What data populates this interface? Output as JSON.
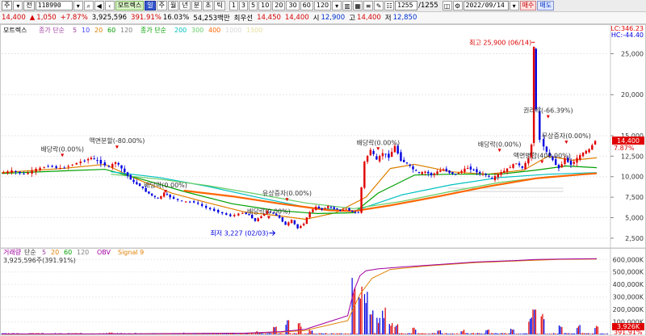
{
  "toolbar": {
    "period_select": "주",
    "mode_select": "전",
    "code": "118990",
    "stock_name": "모트렉스",
    "nav_tabs": [
      "일",
      "주",
      "월",
      "년",
      "분",
      "초",
      "틱"
    ],
    "intervals": [
      "1",
      "3",
      "5",
      "10",
      "20",
      "30",
      "60",
      "120"
    ],
    "range": "1255",
    "range_total": "/1255",
    "date": "2022/09/14",
    "buy_label": "매수",
    "sell_label": "매도"
  },
  "info": {
    "price": "14,400",
    "change_arrow": "▲",
    "change": "1,050",
    "change_pct": "+7.87%",
    "volume": "3,925,596",
    "volume_pct": "391.91%",
    "turnover": "16.03%",
    "amount": "54,253백만",
    "prev_label": "최우선",
    "bid": "14,450",
    "ask": "14,400",
    "open_label": "시",
    "open": "12,900",
    "high_label": "고",
    "high": "14,400",
    "low_label": "저",
    "low": "12,850"
  },
  "colors": {
    "up": "#e00000",
    "down": "#0000e0",
    "ma5": "#a040a0",
    "ma10": "#4040ff",
    "ma20": "#e08000",
    "ma60": "#00a000",
    "ma120": "#808080",
    "ma200": "#00c0c0",
    "ma300": "#66cc66",
    "ma400": "#ff6600",
    "obv": "#a000a0",
    "highlight": "#ffffff"
  },
  "chart_data": [
    {
      "type": "candlestick",
      "title": "모트렉스",
      "legend": {
        "group1_label": "종가 단순",
        "group1": [
          {
            "name": "5",
            "color": "#a040a0"
          },
          {
            "name": "10",
            "color": "#4040ff"
          },
          {
            "name": "20",
            "color": "#e08000"
          },
          {
            "name": "60",
            "color": "#00a000"
          },
          {
            "name": "120",
            "color": "#808080"
          }
        ],
        "group2_label": "종가 단순",
        "group2": [
          {
            "name": "200",
            "color": "#00c0c0"
          },
          {
            "name": "300",
            "color": "#66cc66"
          },
          {
            "name": "400",
            "color": "#ff6600"
          },
          {
            "name": "1000",
            "color": "#d8d8d8"
          },
          {
            "name": "1500",
            "color": "#e8e0a0"
          }
        ]
      },
      "y_ticks": [
        "25,000",
        "20,000",
        "15,000",
        "12,500",
        "10,000",
        "7,500",
        "5,000",
        "2,500"
      ],
      "y_tick_values": [
        25000,
        20000,
        15000,
        12500,
        10000,
        7500,
        5000,
        2500
      ],
      "ylim": [
        1800,
        28000
      ],
      "current_price_label": "14,400",
      "current_change_label": "7.87%",
      "lc_label": "LC:346.23",
      "hc_label": "HC:-44.40",
      "annotations": [
        {
          "text": "배당락(0.00%)",
          "x": 0.1,
          "y": 12300
        },
        {
          "text": "액면분할(-80.00%)",
          "x": 0.19,
          "y": 13300
        },
        {
          "text": "배당락(0.00%)",
          "x": 0.27,
          "y": 7900
        },
        {
          "text": "유상증자(0.00%)",
          "x": 0.47,
          "y": 6900
        },
        {
          "text": "배당락(0.00%)",
          "x": 0.44,
          "y": 4700
        },
        {
          "text": "배당락(0.00%)",
          "x": 0.62,
          "y": 13100
        },
        {
          "text": "배당락(0.00%)",
          "x": 0.82,
          "y": 12900
        },
        {
          "text": "액면병합(400.00%)",
          "x": 0.89,
          "y": 11500
        },
        {
          "text": "권리락(-66.39%)",
          "x": 0.9,
          "y": 17000
        },
        {
          "text": "무상증자(0.00%)",
          "x": 0.93,
          "y": 13900
        },
        {
          "text": "최고 25,900 (06/14)",
          "x": 0.878,
          "y": 25900
        },
        {
          "text": "최저 3,227 (02/03)",
          "x": 0.45,
          "y": 3227
        }
      ],
      "price_series": [
        [
          0.0,
          10400
        ],
        [
          0.02,
          10700
        ],
        [
          0.04,
          10300
        ],
        [
          0.06,
          10900
        ],
        [
          0.08,
          11300
        ],
        [
          0.1,
          11000
        ],
        [
          0.12,
          11500
        ],
        [
          0.14,
          12000
        ],
        [
          0.15,
          12300
        ],
        [
          0.16,
          11900
        ],
        [
          0.18,
          11200
        ],
        [
          0.19,
          11800
        ],
        [
          0.2,
          11000
        ],
        [
          0.21,
          10100
        ],
        [
          0.22,
          9300
        ],
        [
          0.23,
          8900
        ],
        [
          0.24,
          8200
        ],
        [
          0.25,
          7700
        ],
        [
          0.26,
          7300
        ],
        [
          0.27,
          8000
        ],
        [
          0.28,
          7500
        ],
        [
          0.3,
          7000
        ],
        [
          0.32,
          6900
        ],
        [
          0.34,
          6200
        ],
        [
          0.36,
          5700
        ],
        [
          0.38,
          5200
        ],
        [
          0.4,
          5600
        ],
        [
          0.41,
          5300
        ],
        [
          0.42,
          4600
        ],
        [
          0.43,
          5200
        ],
        [
          0.44,
          5800
        ],
        [
          0.45,
          5500
        ],
        [
          0.46,
          5000
        ],
        [
          0.47,
          4100
        ],
        [
          0.48,
          4700
        ],
        [
          0.49,
          3700
        ],
        [
          0.5,
          4300
        ],
        [
          0.51,
          5700
        ],
        [
          0.52,
          6300
        ],
        [
          0.53,
          6000
        ],
        [
          0.54,
          6400
        ],
        [
          0.55,
          6100
        ],
        [
          0.56,
          5900
        ],
        [
          0.57,
          6100
        ],
        [
          0.58,
          5700
        ],
        [
          0.59,
          5600
        ],
        [
          0.6,
          11800
        ],
        [
          0.61,
          13300
        ],
        [
          0.62,
          12000
        ],
        [
          0.63,
          12900
        ],
        [
          0.64,
          12400
        ],
        [
          0.65,
          13700
        ],
        [
          0.66,
          12000
        ],
        [
          0.67,
          11600
        ],
        [
          0.68,
          10900
        ],
        [
          0.69,
          10400
        ],
        [
          0.7,
          10600
        ],
        [
          0.71,
          10200
        ],
        [
          0.72,
          10600
        ],
        [
          0.73,
          10900
        ],
        [
          0.74,
          10500
        ],
        [
          0.75,
          10300
        ],
        [
          0.76,
          10700
        ],
        [
          0.77,
          11100
        ],
        [
          0.78,
          10800
        ],
        [
          0.79,
          10400
        ],
        [
          0.8,
          10200
        ],
        [
          0.81,
          9700
        ],
        [
          0.82,
          10300
        ],
        [
          0.83,
          10700
        ],
        [
          0.84,
          11200
        ],
        [
          0.85,
          11700
        ],
        [
          0.86,
          11000
        ],
        [
          0.87,
          12200
        ],
        [
          0.875,
          14000
        ],
        [
          0.878,
          25900
        ],
        [
          0.882,
          18000
        ],
        [
          0.89,
          14500
        ],
        [
          0.9,
          13000
        ],
        [
          0.91,
          12000
        ],
        [
          0.92,
          11000
        ],
        [
          0.93,
          12200
        ],
        [
          0.94,
          11500
        ],
        [
          0.95,
          12200
        ],
        [
          0.96,
          12900
        ],
        [
          0.97,
          13300
        ],
        [
          0.98,
          14400
        ]
      ],
      "ma_series": [
        {
          "name": "20",
          "color": "#e08000",
          "values": [
            [
              0.0,
              10500
            ],
            [
              0.1,
              11000
            ],
            [
              0.17,
              11500
            ],
            [
              0.22,
              9800
            ],
            [
              0.28,
              8000
            ],
            [
              0.34,
              6800
            ],
            [
              0.4,
              5700
            ],
            [
              0.46,
              5200
            ],
            [
              0.5,
              4800
            ],
            [
              0.55,
              5600
            ],
            [
              0.6,
              7500
            ],
            [
              0.64,
              11000
            ],
            [
              0.68,
              11500
            ],
            [
              0.74,
              10600
            ],
            [
              0.8,
              10300
            ],
            [
              0.86,
              10800
            ],
            [
              0.9,
              12500
            ],
            [
              0.94,
              12000
            ],
            [
              0.98,
              12300
            ]
          ]
        },
        {
          "name": "60",
          "color": "#00a000",
          "values": [
            [
              0.0,
              10400
            ],
            [
              0.1,
              10700
            ],
            [
              0.17,
              10900
            ],
            [
              0.24,
              9500
            ],
            [
              0.3,
              8200
            ],
            [
              0.38,
              6700
            ],
            [
              0.45,
              5900
            ],
            [
              0.52,
              5500
            ],
            [
              0.58,
              5600
            ],
            [
              0.62,
              8000
            ],
            [
              0.68,
              10200
            ],
            [
              0.74,
              10300
            ],
            [
              0.82,
              10300
            ],
            [
              0.88,
              10800
            ],
            [
              0.93,
              11300
            ],
            [
              0.98,
              11100
            ]
          ]
        },
        {
          "name": "200",
          "color": "#00c0c0",
          "values": [
            [
              0.18,
              10600
            ],
            [
              0.26,
              9900
            ],
            [
              0.34,
              8800
            ],
            [
              0.42,
              7500
            ],
            [
              0.5,
              6300
            ],
            [
              0.58,
              5800
            ],
            [
              0.66,
              7800
            ],
            [
              0.74,
              9000
            ],
            [
              0.82,
              9900
            ],
            [
              0.9,
              10300
            ],
            [
              0.98,
              10500
            ]
          ]
        },
        {
          "name": "300",
          "color": "#66cc66",
          "values": [
            [
              0.18,
              10300
            ],
            [
              0.26,
              9700
            ],
            [
              0.34,
              8900
            ],
            [
              0.42,
              7900
            ],
            [
              0.5,
              6800
            ],
            [
              0.58,
              6100
            ],
            [
              0.66,
              7000
            ],
            [
              0.74,
              8200
            ],
            [
              0.82,
              9300
            ],
            [
              0.9,
              10000
            ],
            [
              0.98,
              10400
            ]
          ]
        },
        {
          "name": "400",
          "color": "#ff6600",
          "values": [
            [
              0.3,
              8300
            ],
            [
              0.38,
              7600
            ],
            [
              0.46,
              6700
            ],
            [
              0.54,
              5900
            ],
            [
              0.58,
              5800
            ],
            [
              0.64,
              6500
            ],
            [
              0.72,
              7600
            ],
            [
              0.8,
              8800
            ],
            [
              0.88,
              9800
            ],
            [
              0.96,
              10300
            ],
            [
              0.98,
              10400
            ]
          ]
        }
      ],
      "highlight_lines": [
        {
          "y": 8400,
          "x0": 0.735,
          "x1": 0.925,
          "color": "#ffffff"
        }
      ]
    },
    {
      "type": "bar",
      "title": "거래량",
      "legend_label": "단순",
      "legend": [
        {
          "name": "5",
          "color": "#a040a0"
        },
        {
          "name": "20",
          "color": "#e08000"
        },
        {
          "name": "60",
          "color": "#00a000"
        },
        {
          "name": "120",
          "color": "#808080"
        }
      ],
      "obv_label": "OBV",
      "signal_label": "Signal 9",
      "volume_label": "3,925,596주(391.91%)",
      "y_ticks": [
        "600,000K",
        "500,000K",
        "400,000K",
        "300,000K",
        "200,000K",
        "100,000K"
      ],
      "y_tick_values": [
        600000,
        500000,
        400000,
        300000,
        200000,
        100000
      ],
      "ylim": [
        0,
        660000
      ],
      "current_label": "3,926K",
      "current_pct_label": "391.91%",
      "volume_spikes": [
        [
          0.05,
          9000
        ],
        [
          0.12,
          7000
        ],
        [
          0.18,
          11000
        ],
        [
          0.22,
          8000
        ],
        [
          0.3,
          10000
        ],
        [
          0.38,
          9000
        ],
        [
          0.42,
          18000
        ],
        [
          0.45,
          42000
        ],
        [
          0.47,
          75000
        ],
        [
          0.49,
          60000
        ],
        [
          0.51,
          30000
        ],
        [
          0.58,
          330000
        ],
        [
          0.59,
          290000
        ],
        [
          0.6,
          230000
        ],
        [
          0.61,
          160000
        ],
        [
          0.62,
          90000
        ],
        [
          0.63,
          140000
        ],
        [
          0.64,
          70000
        ],
        [
          0.65,
          60000
        ],
        [
          0.68,
          40000
        ],
        [
          0.72,
          30000
        ],
        [
          0.76,
          25000
        ],
        [
          0.8,
          30000
        ],
        [
          0.84,
          35000
        ],
        [
          0.87,
          90000
        ],
        [
          0.878,
          180000
        ],
        [
          0.89,
          110000
        ],
        [
          0.92,
          60000
        ],
        [
          0.95,
          50000
        ],
        [
          0.98,
          45000
        ]
      ],
      "obv_series": [
        [
          0.0,
          3000
        ],
        [
          0.2,
          4000
        ],
        [
          0.4,
          10000
        ],
        [
          0.44,
          18000
        ],
        [
          0.46,
          22000
        ],
        [
          0.5,
          40000
        ],
        [
          0.57,
          150000
        ],
        [
          0.58,
          350000
        ],
        [
          0.59,
          470000
        ],
        [
          0.6,
          510000
        ],
        [
          0.62,
          525000
        ],
        [
          0.66,
          540000
        ],
        [
          0.72,
          560000
        ],
        [
          0.78,
          580000
        ],
        [
          0.84,
          590000
        ],
        [
          0.88,
          600000
        ],
        [
          0.92,
          603000
        ],
        [
          0.98,
          606000
        ]
      ],
      "signal_series": [
        [
          0.0,
          2000
        ],
        [
          0.2,
          3500
        ],
        [
          0.4,
          8000
        ],
        [
          0.46,
          18000
        ],
        [
          0.5,
          32000
        ],
        [
          0.57,
          110000
        ],
        [
          0.59,
          320000
        ],
        [
          0.61,
          450000
        ],
        [
          0.64,
          520000
        ],
        [
          0.7,
          548000
        ],
        [
          0.78,
          575000
        ],
        [
          0.86,
          590000
        ],
        [
          0.92,
          601000
        ],
        [
          0.98,
          604000
        ]
      ]
    }
  ]
}
